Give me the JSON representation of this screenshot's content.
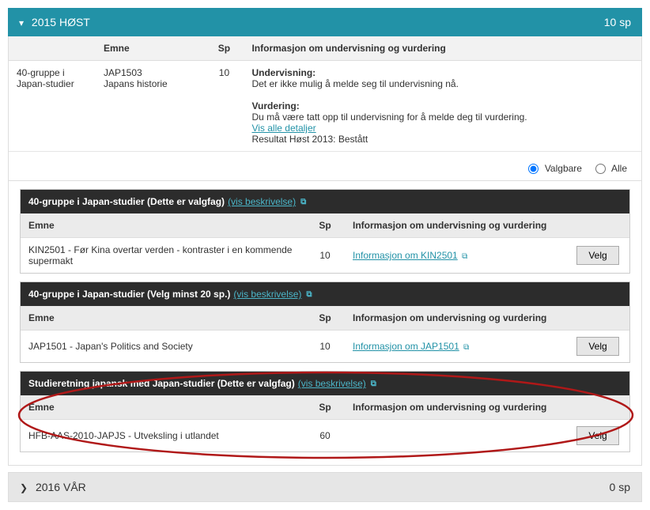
{
  "semesters": {
    "current": {
      "chevron": "▾",
      "title": "2015 HØST",
      "sp": "10 sp"
    },
    "next": {
      "chevron": "❯",
      "title": "2016 VÅR",
      "sp": "0 sp"
    }
  },
  "main_table": {
    "headers": {
      "group": "",
      "emne": "Emne",
      "sp": "Sp",
      "info": "Informasjon om undervisning og vurdering"
    },
    "row": {
      "group": "40-gruppe i Japan-studier",
      "emne_code": "JAP1503",
      "emne_name": "Japans historie",
      "sp": "10",
      "undervisning_label": "Undervisning:",
      "undervisning_text": "Det er ikke mulig å melde seg til undervisning nå.",
      "vurdering_label": "Vurdering:",
      "vurdering_text": "Du må være tatt opp til undervisning for å melde deg til vurdering.",
      "details_link": "Vis alle detaljer",
      "result_text": "Resultat Høst 2013: Bestått"
    }
  },
  "radios": {
    "valgbare": "Valgbare",
    "alle": "Alle"
  },
  "blocks": [
    {
      "title": "40-gruppe i Japan-studier (Dette er valgfag)",
      "desc_link": "(vis beskrivelse)",
      "headers": {
        "emne": "Emne",
        "sp": "Sp",
        "info": "Informasjon om undervisning og vurdering"
      },
      "row": {
        "emne": "KIN2501 - Før Kina overtar verden - kontraster i en kommende supermakt",
        "sp": "10",
        "info_link": "Informasjon om KIN2501",
        "btn": "Velg"
      }
    },
    {
      "title": "40-gruppe i Japan-studier (Velg minst 20 sp.)",
      "desc_link": "(vis beskrivelse)",
      "headers": {
        "emne": "Emne",
        "sp": "Sp",
        "info": "Informasjon om undervisning og vurdering"
      },
      "row": {
        "emne": "JAP1501 - Japan's Politics and Society",
        "sp": "10",
        "info_link": "Informasjon om JAP1501",
        "btn": "Velg"
      }
    },
    {
      "title": "Studieretning japansk med Japan-studier (Dette er valgfag)",
      "desc_link": "(vis beskrivelse)",
      "headers": {
        "emne": "Emne",
        "sp": "Sp",
        "info": "Informasjon om undervisning og vurdering"
      },
      "row": {
        "emne": "HFB-AAS-2010-JAPJS - Utveksling i utlandet",
        "sp": "60",
        "info_link": "",
        "btn": "Velg"
      }
    }
  ]
}
